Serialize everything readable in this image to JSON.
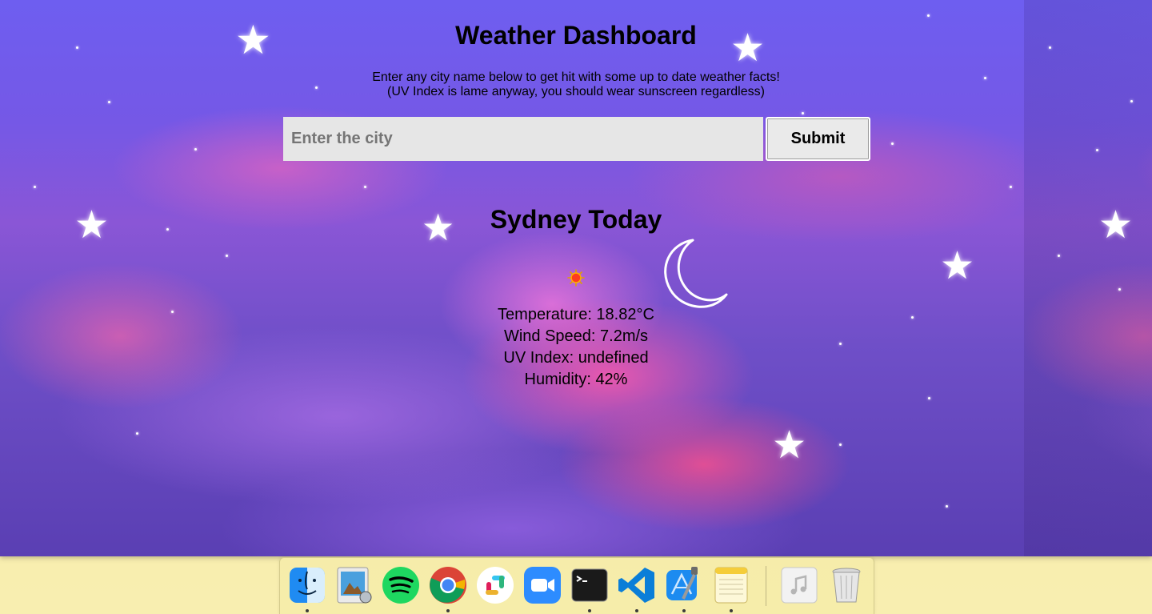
{
  "page": {
    "title": "Weather Dashboard",
    "intro_line1": "Enter any city name below to get hit with some up to date weather facts!",
    "intro_line2": "(UV Index is lame anyway, you should wear sunscreen regardless)"
  },
  "search": {
    "placeholder": "Enter the city",
    "value": "",
    "submit_label": "Submit"
  },
  "today": {
    "heading": "Sydney Today",
    "icon": "sun-icon",
    "temperature": "Temperature: 18.82°C",
    "wind_speed": "Wind Speed: 7.2m/s",
    "uv_index": "UV Index: undefined",
    "humidity": "Humidity: 42%"
  },
  "dock": {
    "apps": [
      "finder-icon",
      "preview-icon",
      "spotify-icon",
      "chrome-icon",
      "slack-icon",
      "zoom-icon",
      "terminal-icon",
      "vscode-icon",
      "xcode-icon",
      "notes-icon",
      "music-icon",
      "trash-icon"
    ]
  },
  "colors": {
    "sky_top": "#6e5ef0",
    "cloud_pink": "#ff5aaa",
    "input_bg": "#e6e6e6",
    "dock_bg": "#f6ecaa"
  }
}
